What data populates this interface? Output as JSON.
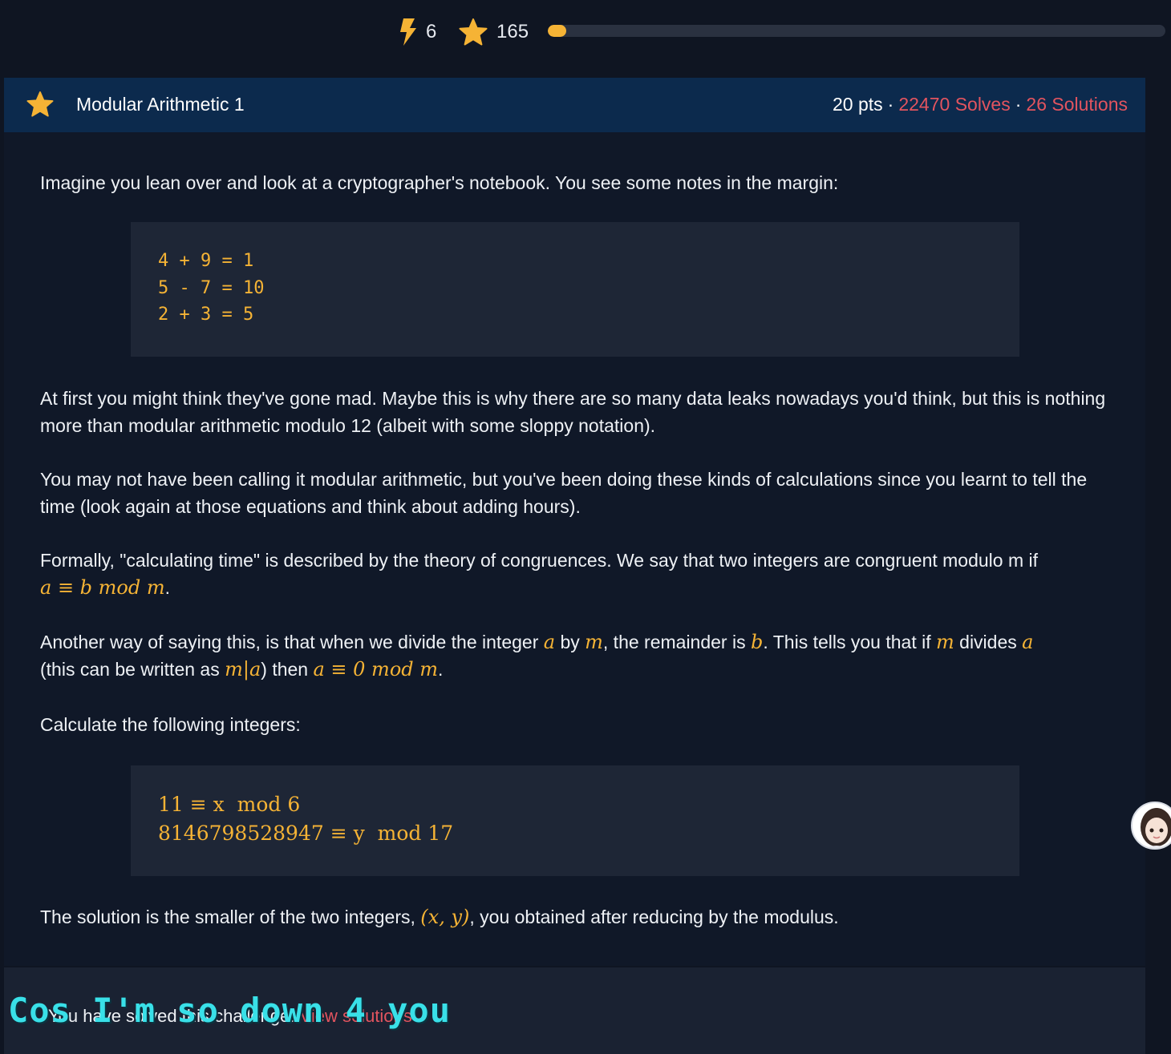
{
  "topbar": {
    "streak_count": "6",
    "score": "165",
    "progress_fraction": 0.03
  },
  "challenge": {
    "title": "Modular Arithmetic 1",
    "points": "20 pts",
    "solves": "22470 Solves",
    "solutions": "26 Solutions"
  },
  "body": {
    "intro": "Imagine you lean over and look at a cryptographer's notebook. You see some notes in the margin:",
    "code_lines": [
      "4 + 9 = 1",
      "5 - 7 = 10",
      "2 + 3 = 5"
    ],
    "para1": "At first you might think they've gone mad. Maybe this is why there are so many data leaks nowadays you'd think, but this is nothing more than modular arithmetic modulo 12 (albeit with some sloppy notation).",
    "para2": "You may not have been calling it modular arithmetic, but you've been doing these kinds of calculations since you learnt to tell the time (look again at those equations and think about adding hours).",
    "para3_text": "Formally, \"calculating time\" is described by the theory of congruences. We say that two integers are congruent modulo m if",
    "para3_math": "a ≡ b  mod m",
    "para4_a": "Another way of saying this, is that when we divide the integer",
    "para4_b": "by",
    "para4_c": ", the remainder is",
    "para4_d": ". This tells you that if",
    "para4_e": "divides",
    "para4_f": "(this can be written as",
    "para4_g": ") then",
    "var_a": "a",
    "var_b": "b",
    "var_m": "m",
    "divides_math": "m|a",
    "zero_math": "a ≡ 0  mod m",
    "para5": "Calculate the following integers:",
    "math_line1": "11 ≡ x  mod 6",
    "math_line2": "8146798528947 ≡ y  mod 17",
    "para6_a": "The solution is the smaller of the two integers,",
    "para6_math": "(x, y)",
    "para6_b": ", you obtained after reducing by the modulus."
  },
  "footer": {
    "solved_text": "You have solved this challenge!",
    "view_solutions": "View solutions",
    "overlay_caption": "Cos I'm so down 4 you"
  },
  "colors": {
    "accent": "#f5b335",
    "link_red": "#e2545f",
    "header_bg": "#0c2a4d",
    "page_bg": "#0f1522",
    "code_bg": "#1e2636"
  }
}
